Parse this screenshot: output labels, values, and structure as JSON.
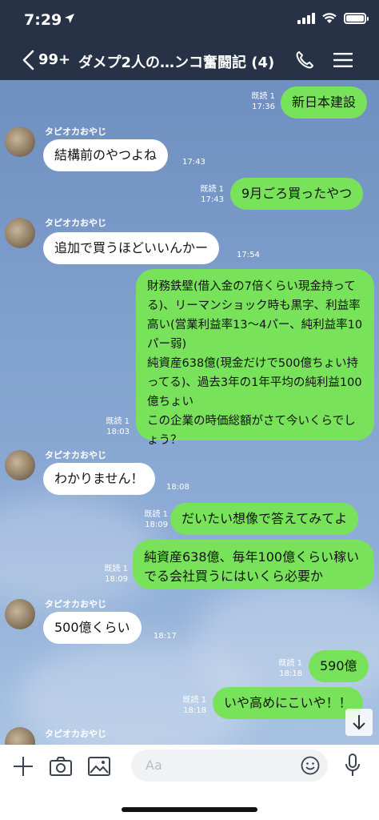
{
  "status": {
    "time": "7:29"
  },
  "header": {
    "back_count": "99+",
    "title": "ダメプ2人の…ンコ奮闘記 (4)"
  },
  "messages": [
    {
      "dir": "out",
      "text": "新日本建設",
      "read": "既読 1",
      "time": "17:36"
    },
    {
      "dir": "in",
      "sender": "タピオカおやじ",
      "text": "結構前のやつよね",
      "time": "17:43"
    },
    {
      "dir": "out",
      "text": "9月ごろ買ったやつ",
      "read": "既読 1",
      "time": "17:43"
    },
    {
      "dir": "in",
      "sender": "タピオカおやじ",
      "text": "追加で買うほどいいんかー",
      "time": "17:54"
    },
    {
      "dir": "out",
      "text": "財務鉄壁(借入金の7倍くらい現金持ってる)、リーマンショック時も黒字、利益率高い(営業利益率13〜4パー、純利益率10パー弱)\n純資産638億(現金だけで500億ちょい持ってる)、過去3年の1年平均の純利益100億ちょい\nこの企業の時価総額がさて今いくらでしょう？",
      "read": "既読 1",
      "time": "18:03"
    },
    {
      "dir": "in",
      "sender": "タピオカおやじ",
      "text": "わかりません！",
      "time": "18:08"
    },
    {
      "dir": "out",
      "text": "だいたい想像で答えてみてよ",
      "read": "既読 1",
      "time": "18:09"
    },
    {
      "dir": "out",
      "text": "純資産638億、毎年100億くらい稼いでる会社買うにはいくら必要か",
      "read": "既読 1",
      "time": "18:09"
    },
    {
      "dir": "in",
      "sender": "タピオカおやじ",
      "text": "500億くらい",
      "time": "18:17"
    },
    {
      "dir": "out",
      "text": "590億",
      "read": "既読 1",
      "time": "18:18"
    },
    {
      "dir": "out",
      "text": "いや高めにこいや！！",
      "read": "既読 1",
      "time": "18:18"
    },
    {
      "dir": "in",
      "sender": "タピオカおやじ"
    }
  ],
  "input": {
    "placeholder": "Aa"
  },
  "colors": {
    "header_bg": "#273246",
    "outgoing_bubble": "#79e25b",
    "incoming_bubble": "#ffffff"
  }
}
